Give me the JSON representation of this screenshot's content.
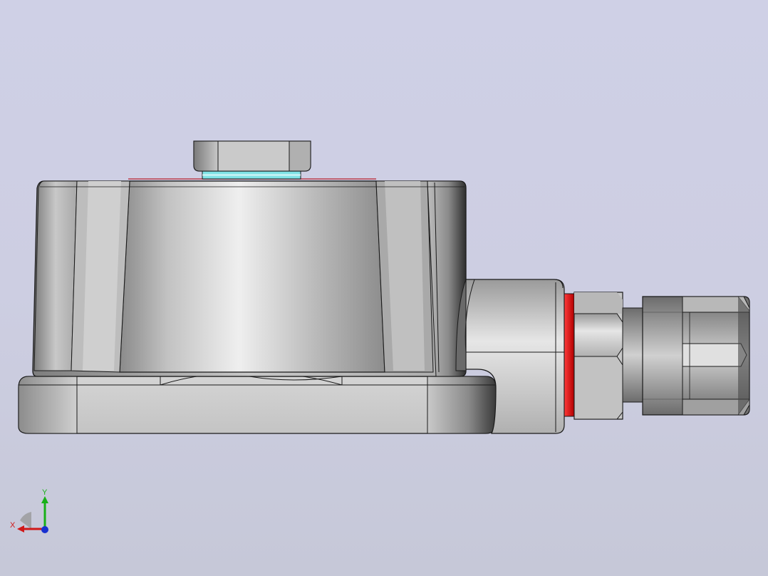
{
  "view": {
    "background_top": "#cfd0e6",
    "background_bottom": "#c6c8d8"
  },
  "model": {
    "part_color": "#c9c9c9",
    "edge_color": "#1a1a1a",
    "seal_ring_color": "#e01515",
    "washer_color": "#7fe3e6"
  },
  "triad": {
    "x_label": "X",
    "y_label": "Y",
    "x_color": "#d01818",
    "y_color": "#18b018",
    "z_color": "#1830d0"
  }
}
